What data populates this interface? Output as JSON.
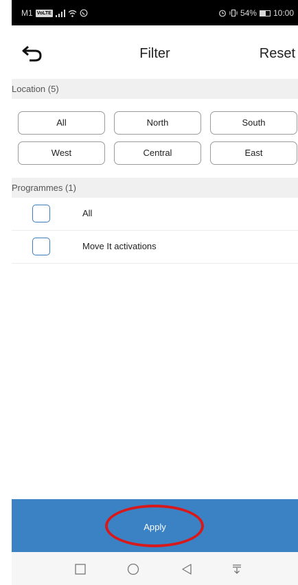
{
  "status_bar": {
    "carrier": "M1",
    "network_badge": "VoLTE",
    "battery_percent": "54%",
    "battery_level": 0.54,
    "time": "10:00",
    "icons": [
      "signal-icon",
      "wifi-icon",
      "whatsapp-icon",
      "alarm-icon",
      "vibrate-icon",
      "battery-icon"
    ]
  },
  "header": {
    "title": "Filter",
    "reset_label": "Reset",
    "back_icon": "back-arrow-icon"
  },
  "location": {
    "heading": "Location (5)",
    "options": [
      "All",
      "North",
      "South",
      "West",
      "Central",
      "East"
    ]
  },
  "programmes": {
    "heading": "Programmes (1)",
    "items": [
      {
        "label": "All",
        "checked": false
      },
      {
        "label": "Move It activations",
        "checked": false
      }
    ]
  },
  "apply": {
    "label": "Apply",
    "background": "#3b82c4",
    "highlight_color": "#d7191c"
  },
  "nav_bar": {
    "icons": [
      "recents-square-icon",
      "home-circle-icon",
      "back-triangle-icon",
      "notification-pulldown-icon"
    ]
  }
}
